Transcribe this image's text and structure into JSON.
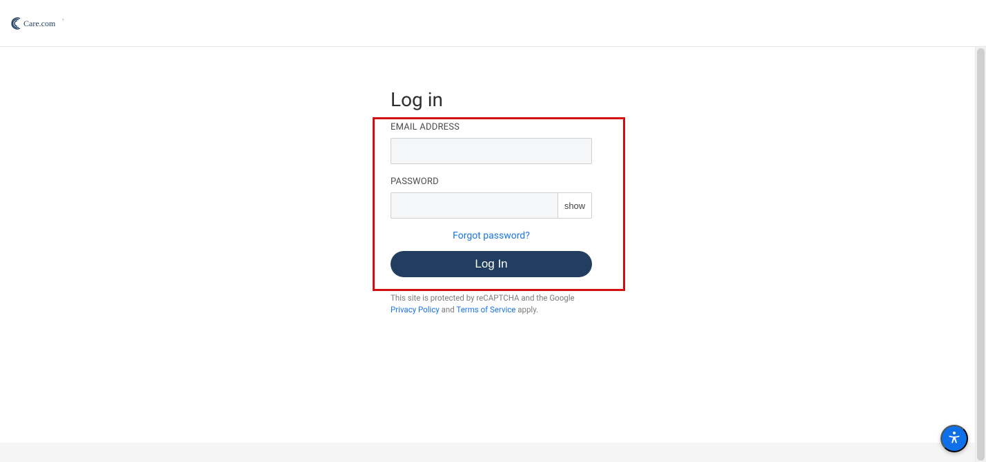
{
  "brand": {
    "name": "Care.com"
  },
  "login": {
    "title": "Log in",
    "email_label": "EMAIL ADDRESS",
    "password_label": "PASSWORD",
    "show_toggle": "show",
    "forgot": "Forgot password?",
    "submit": "Log In"
  },
  "recaptcha": {
    "pre": "This site is protected by reCAPTCHA and the Google ",
    "privacy": "Privacy Policy",
    "and": " and ",
    "tos": "Terms of Service",
    "apply": " apply."
  },
  "colors": {
    "brand_navy": "#213e60",
    "link_blue": "#1a73e8",
    "annot_red": "#d40e0e"
  }
}
